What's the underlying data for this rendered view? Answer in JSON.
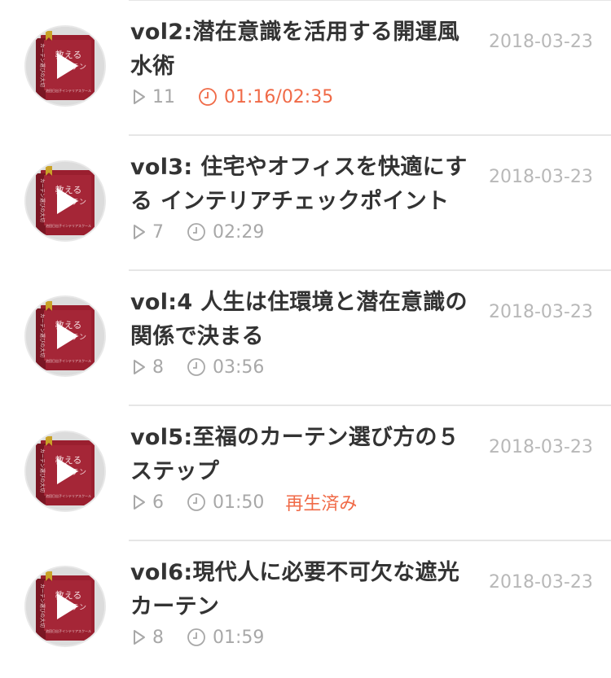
{
  "colors": {
    "accent": "#f06a47",
    "title_text": "#333333",
    "meta_text": "#a8a8a8",
    "date_text": "#b8b8b8",
    "book_red": "#8e1b2b",
    "divider": "#e6e6e6"
  },
  "episodes": [
    {
      "title": "vol2:潜在意識を活用する開運風水術",
      "date": "2018-03-23",
      "plays": "11",
      "duration": "01:16/02:35",
      "duration_active": true,
      "played_label": ""
    },
    {
      "title": "vol3: 住宅やオフィスを快適にする インテリアチェックポイント",
      "date": "2018-03-23",
      "plays": "7",
      "duration": "02:29",
      "duration_active": false,
      "played_label": ""
    },
    {
      "title": "vol:4 人生は住環境と潜在意識の関係で決まる",
      "date": "2018-03-23",
      "plays": "8",
      "duration": "03:56",
      "duration_active": false,
      "played_label": ""
    },
    {
      "title": "vol5:至福のカーテン選び方の５ステップ",
      "date": "2018-03-23",
      "plays": "6",
      "duration": "01:50",
      "duration_active": false,
      "played_label": "再生済み"
    },
    {
      "title": "vol6:現代人に必要不可欠な遮光カーテン",
      "date": "2018-03-23",
      "plays": "8",
      "duration": "01:59",
      "duration_active": false,
      "played_label": ""
    }
  ],
  "thumbnail": {
    "cover_text_top": "教える",
    "cover_text_mid": "カーテン",
    "spine_text": "カーテン選びの大切",
    "footer_text": "池田日出子インテリアスクール",
    "icon": "play-icon"
  },
  "icons": {
    "plays": "play-count-icon",
    "duration": "clock-icon"
  }
}
